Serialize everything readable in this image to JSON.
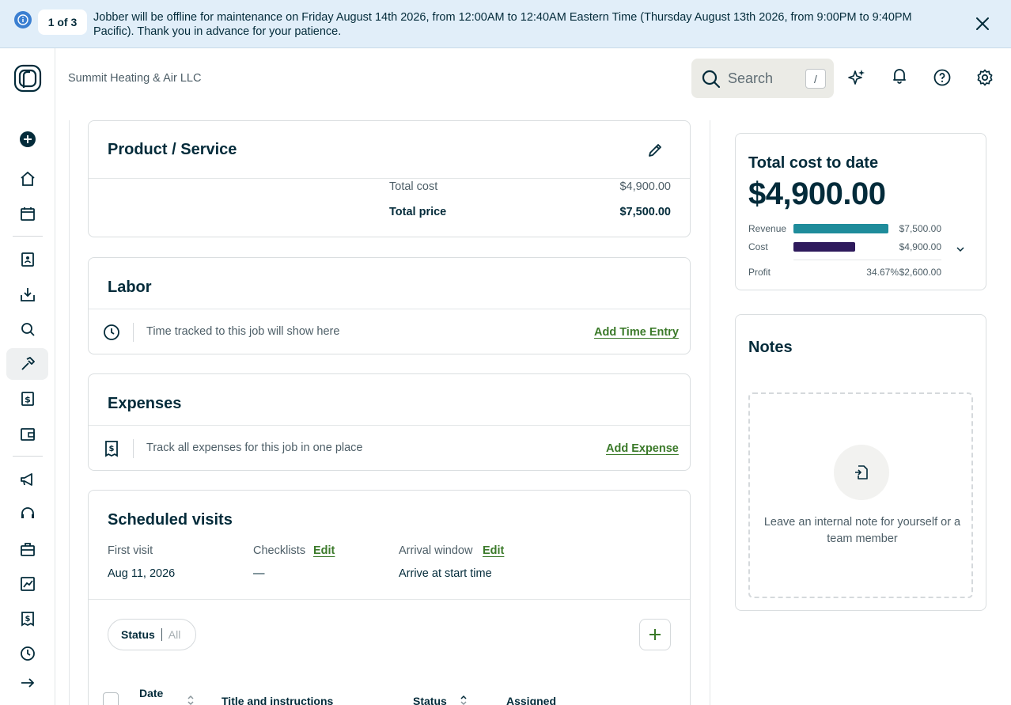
{
  "banner": {
    "counter": "1 of 3",
    "message": "Jobber will be offline for maintenance on Friday August 14th 2026, from 12:00AM to 12:40AM Eastern Time (Thursday August 13th 2026, from 9:00PM to 9:40PM Pacific). Thank you in advance for your patience."
  },
  "header": {
    "company": "Summit Heating & Air LLC",
    "search_placeholder": "Search",
    "search_shortcut": "/"
  },
  "product_service": {
    "title": "Product / Service",
    "total_cost_label": "Total cost",
    "total_cost_value": "$4,900.00",
    "total_price_label": "Total price",
    "total_price_value": "$7,500.00"
  },
  "labor": {
    "title": "Labor",
    "empty_text": "Time tracked to this job will show here",
    "action": "Add Time Entry"
  },
  "expenses": {
    "title": "Expenses",
    "empty_text": "Track all expenses for this job in one place",
    "action": "Add Expense"
  },
  "visits": {
    "title": "Scheduled visits",
    "first_visit_label": "First visit",
    "first_visit_value": "Aug 11, 2026",
    "checklists_label": "Checklists",
    "checklists_edit": "Edit",
    "checklists_value": "—",
    "arrival_label": "Arrival window",
    "arrival_edit": "Edit",
    "arrival_value": "Arrive at start time",
    "filter_key": "Status",
    "filter_value": "All",
    "columns": [
      "Date",
      "Title and instructions",
      "Status",
      "Assigned"
    ]
  },
  "cost_summary": {
    "title": "Total cost to date",
    "amount": "$4,900.00",
    "revenue_label": "Revenue",
    "revenue_value": "$7,500.00",
    "revenue_fraction": 1.0,
    "cost_label": "Cost",
    "cost_value": "$4,900.00",
    "cost_fraction": 0.6533,
    "profit_label": "Profit",
    "profit_pct": "34.67%",
    "profit_value": "$2,600.00",
    "colors": {
      "revenue": "#1f8c9b",
      "cost": "#2e1a5c"
    }
  },
  "notes": {
    "title": "Notes",
    "empty_text": "Leave an internal note for yourself or a team member"
  },
  "sidebar_icons": [
    "create-icon",
    "home-icon",
    "schedule-icon",
    "clients-icon",
    "requests-icon",
    "quotes-icon",
    "jobs-icon",
    "invoices-icon",
    "payments-icon",
    "marketing-icon",
    "support-icon",
    "apps-icon",
    "insights-icon",
    "expenses-icon",
    "timesheets-icon",
    "expand-icon"
  ]
}
